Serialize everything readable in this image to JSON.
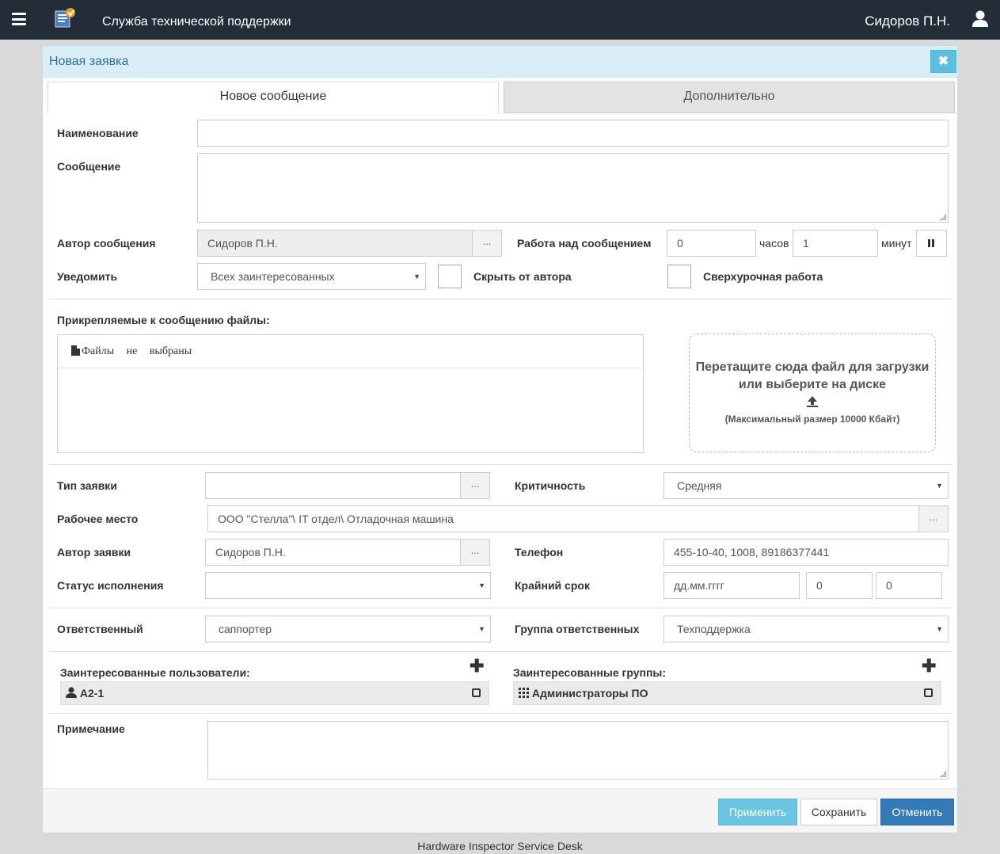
{
  "header": {
    "app_title": "Служба технической поддержки",
    "user_name": "Сидоров П.Н.",
    "colors": {
      "topbar": "#222d38"
    }
  },
  "modal": {
    "title": "Новая заявка",
    "close_icon": "times-icon",
    "tabs": [
      {
        "label": "Новое сообщение",
        "active": true
      },
      {
        "label": "Дополнительно",
        "active": false
      }
    ],
    "message": {
      "name_label": "Наименование",
      "name_value": "",
      "text_label": "Сообщение",
      "text_value": "",
      "author_label": "Автор сообщения",
      "author_value": "Сидоров П.Н.",
      "ellipsis": "...",
      "work_label": "Работа над сообщением",
      "hours_value": "0",
      "hours_unit": "часов",
      "minutes_value": "1",
      "minutes_unit": "минут",
      "pause_icon": "pause-icon",
      "notify_label": "Уведомить",
      "notify_value": "Всех заинтересованных",
      "hide_label": "Скрыть от автора",
      "overtime_label": "Сверхурочная работа"
    },
    "files": {
      "label": "Прикрепляемые к сообщению файлы:",
      "empty_text": "Файлы не выбраны",
      "drop_text_1": "Перетащите сюда файл для загрузки",
      "drop_text_2": "или выберите на диске",
      "drop_max": "(Максимальный размер 10000 Кбайт)",
      "upload_icon": "upload-icon"
    },
    "request": {
      "type_label": "Тип заявки",
      "type_value": "",
      "criticality_label": "Критичность",
      "criticality_value": "Средняя",
      "workplace_label": "Рабочее место",
      "workplace_value": "ООО \"Стелла\"\\ IT отдел\\ Отладочная машина",
      "author_label": "Автор заявки",
      "author_value": "Сидоров П.Н.",
      "phone_label": "Телефон",
      "phone_value": "455-10-40, 1008, 89186377441",
      "status_label": "Статус исполнения",
      "status_value": "",
      "deadline_label": "Крайний срок",
      "deadline_placeholder": "дд.мм.гггг",
      "deadline_hours": "0",
      "deadline_minutes": "0",
      "responsible_label": "Ответственный",
      "responsible_value": "саппортер",
      "group_label": "Группа ответственных",
      "group_value": "Техподдержка"
    },
    "interested": {
      "users_label": "Заинтересованные пользователи:",
      "users": [
        "А2-1"
      ],
      "groups_label": "Заинтересованные группы:",
      "groups": [
        "Администраторы ПО"
      ]
    },
    "note_label": "Примечание",
    "note_value": "",
    "buttons": {
      "apply": "Применить",
      "save": "Сохранить",
      "cancel": "Отменить"
    }
  },
  "footer_text": "Hardware Inspector Service Desk"
}
